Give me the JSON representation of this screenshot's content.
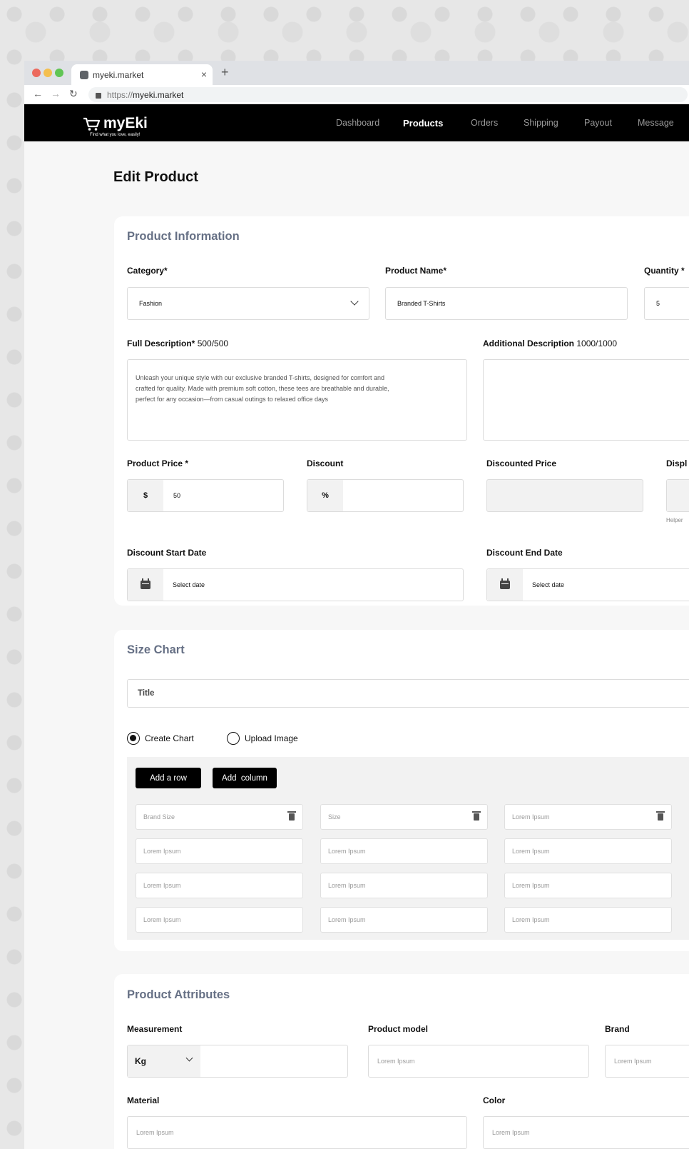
{
  "browser": {
    "tab_title": "myeki.market",
    "tab_close": "×",
    "new_tab": "+",
    "url_scheme": "https://",
    "url_host": "myeki.market",
    "back": "←",
    "forward": "→",
    "reload": "↻"
  },
  "brand": {
    "name": "myEki",
    "tagline": "Find what you love, easily!"
  },
  "nav": {
    "items": [
      "Dashboard",
      "Products",
      "Orders",
      "Shipping",
      "Payout",
      "Message"
    ],
    "active": "Products"
  },
  "page": {
    "title": "Edit Product"
  },
  "product_info": {
    "title": "Product Information",
    "category_label": "Category*",
    "category_value": "Fashion",
    "name_label": "Product Name*",
    "name_value": "Branded T-Shirts",
    "quantity_label": "Quantity *",
    "quantity_value": "5",
    "full_desc_label": "Full Description*",
    "full_desc_count": "500/500",
    "full_desc_text": "Unleash your unique style with our exclusive branded T-shirts, designed for comfort and\n crafted for quality. Made with premium soft cotton, these tees are breathable and durable,\nperfect for any occasion—from casual outings to relaxed office days",
    "add_desc_label": "Additional Description",
    "add_desc_count": "1000/1000",
    "add_desc_text": "",
    "price_label": "Product Price *",
    "price_prefix": "$",
    "price_value": "50",
    "discount_label": "Discount",
    "discount_prefix": "%",
    "discount_value": "",
    "discounted_label": "Discounted Price",
    "display_label": "Displ",
    "display_prefix": "$",
    "helper_text": "Helper",
    "start_date_label": "Discount Start Date",
    "start_date_value": "Select date",
    "end_date_label": "Discount End Date",
    "end_date_value": "Select date"
  },
  "size_chart": {
    "title": "Size Chart",
    "title_field": "Title",
    "radio_create": "Create Chart",
    "radio_upload": "Upload Image",
    "selected": "Create Chart",
    "add_row": "Add a row",
    "add_column": "Add  column",
    "headers": [
      "Brand Size",
      "Size",
      "Lorem Ipsum"
    ],
    "rows": [
      [
        "Lorem Ipsum",
        "Lorem Ipsum",
        "Lorem Ipsum"
      ],
      [
        "Lorem Ipsum",
        "Lorem Ipsum",
        "Lorem Ipsum"
      ],
      [
        "Lorem Ipsum",
        "Lorem Ipsum",
        "Lorem Ipsum"
      ]
    ]
  },
  "attributes": {
    "title": "Product Attributes",
    "measurement_label": "Measurement",
    "measurement_unit": "Kg",
    "measurement_value": "",
    "model_label": "Product model",
    "model_placeholder": "Lorem Ipsum",
    "brand_label": "Brand",
    "brand_placeholder": "Lorem Ipsum",
    "material_label": "Material",
    "material_placeholder": "Lorem Ipsum",
    "color_label": "Color",
    "color_placeholder": "Lorem Ipsum"
  },
  "colors": {
    "nav_bg": "#000000",
    "card_title": "#667085",
    "page_bg": "#f7f7f7",
    "mac_red": "#ec6a5e",
    "mac_yellow": "#f4bf4f",
    "mac_green": "#61c554"
  }
}
